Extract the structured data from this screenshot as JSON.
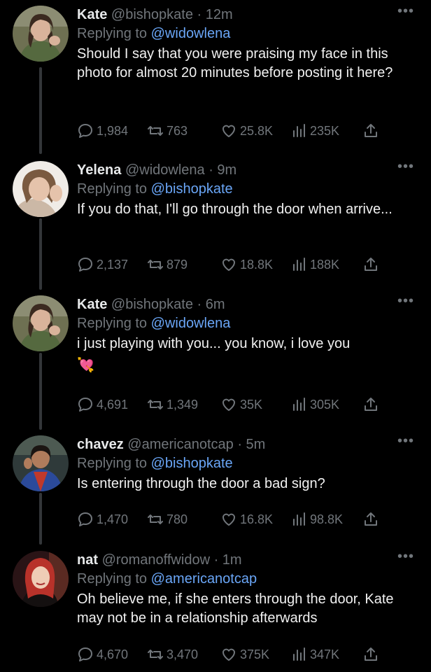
{
  "colors": {
    "background": "#000000",
    "text": "#e7e9ea",
    "muted": "#71767b",
    "mention": "#6aa6f7"
  },
  "tweets": [
    {
      "name": "Kate",
      "handle": "@bishopkate",
      "time": "· 12m",
      "replying_prefix": "Replying to",
      "replying_to": "@widowlena",
      "text": "Should I say that you were praising my face in this photo for almost 20 minutes before posting it here?",
      "emoji": "",
      "stats": {
        "replies": "1,984",
        "retweets": "763",
        "likes": "25.8K",
        "views": "235K"
      },
      "avatar": "kate-photo"
    },
    {
      "name": "Yelena",
      "handle": "@widowlena",
      "time": "· 9m",
      "replying_prefix": "Replying to",
      "replying_to": "@bishopkate",
      "text": "If you do that, I'll go through the door when arrive...",
      "emoji": "",
      "stats": {
        "replies": "2,137",
        "retweets": "879",
        "likes": "18.8K",
        "views": "188K"
      },
      "avatar": "yelena-photo"
    },
    {
      "name": "Kate",
      "handle": "@bishopkate",
      "time": "· 6m",
      "replying_prefix": "Replying to",
      "replying_to": "@widowlena",
      "text": "i just playing with you... you know, i love you",
      "emoji": "💘",
      "stats": {
        "replies": "4,691",
        "retweets": "1,349",
        "likes": "35K",
        "views": "305K"
      },
      "avatar": "kate-photo"
    },
    {
      "name": "chavez",
      "handle": "@americanotcap",
      "time": "· 5m",
      "replying_prefix": "Replying to",
      "replying_to": "@bishopkate",
      "text": "Is entering through the door a bad sign?",
      "emoji": "",
      "stats": {
        "replies": "1,470",
        "retweets": "780",
        "likes": "16.8K",
        "views": "98.8K"
      },
      "avatar": "chavez-photo"
    },
    {
      "name": "nat",
      "handle": "@romanoffwidow",
      "time": "· 1m",
      "replying_prefix": "Replying to",
      "replying_to": "@americanotcap",
      "text": "Oh believe me, if she enters through the door, Kate may not be in a relationship afterwards",
      "emoji": "",
      "stats": {
        "replies": "4,670",
        "retweets": "3,470",
        "likes": "375K",
        "views": "347K"
      },
      "avatar": "nat-photo"
    }
  ],
  "more_label": "•••"
}
